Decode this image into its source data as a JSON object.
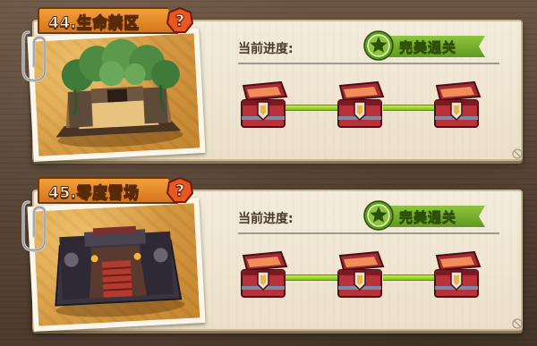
{
  "stages": [
    {
      "title": "44.生命禁区",
      "help_symbol": "?",
      "progress_label": "当前进度:",
      "status_text": "完美通关",
      "chests": [
        {
          "icon": "treasure-chest-icon",
          "state": "opened"
        },
        {
          "icon": "treasure-chest-icon",
          "state": "opened"
        },
        {
          "icon": "treasure-chest-icon",
          "state": "opened"
        }
      ],
      "scene": "forest-ruins"
    },
    {
      "title": "45.零度雪场",
      "help_symbol": "?",
      "progress_label": "当前进度:",
      "status_text": "完美通关",
      "chests": [
        {
          "icon": "treasure-chest-icon",
          "state": "opened"
        },
        {
          "icon": "treasure-chest-icon",
          "state": "opened"
        },
        {
          "icon": "treasure-chest-icon",
          "state": "opened"
        }
      ],
      "scene": "dark-fortress"
    }
  ],
  "colors": {
    "title_tab": "#e08a28",
    "perfect_badge": "#6fa82a",
    "connector": "#a4dc34",
    "chest_body": "#b8323a",
    "panel": "#f1e8d4"
  }
}
